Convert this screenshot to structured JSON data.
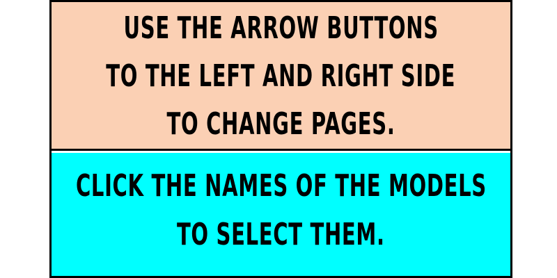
{
  "instructions": {
    "navigation": {
      "lines": [
        "USE THE ARROW BUTTONS",
        "TO THE LEFT AND RIGHT SIDE",
        "TO CHANGE PAGES."
      ]
    },
    "selection": {
      "lines": [
        "CLICK THE NAMES OF THE MODELS",
        "TO SELECT THEM."
      ]
    }
  },
  "colors": {
    "navigation_background": "#fbd0b4",
    "selection_background": "#00ffff",
    "border": "#000000",
    "text": "#000000"
  }
}
